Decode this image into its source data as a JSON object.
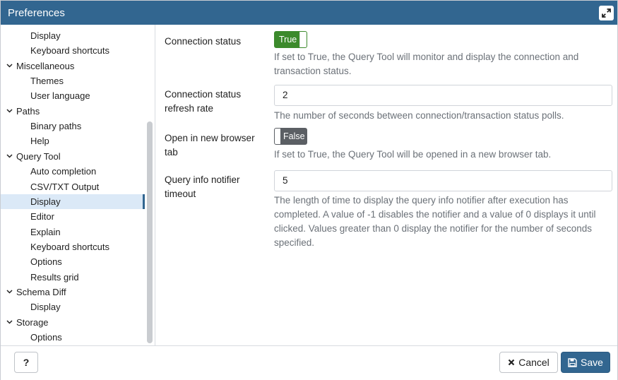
{
  "dialog": {
    "title": "Preferences"
  },
  "tree": [
    {
      "label": "Display",
      "type": "leaf",
      "selected": false
    },
    {
      "label": "Keyboard shortcuts",
      "type": "leaf",
      "selected": false
    },
    {
      "label": "Miscellaneous",
      "type": "group",
      "selected": false
    },
    {
      "label": "Themes",
      "type": "leaf",
      "selected": false
    },
    {
      "label": "User language",
      "type": "leaf",
      "selected": false
    },
    {
      "label": "Paths",
      "type": "group",
      "selected": false
    },
    {
      "label": "Binary paths",
      "type": "leaf",
      "selected": false
    },
    {
      "label": "Help",
      "type": "leaf",
      "selected": false
    },
    {
      "label": "Query Tool",
      "type": "group",
      "selected": false
    },
    {
      "label": "Auto completion",
      "type": "leaf",
      "selected": false
    },
    {
      "label": "CSV/TXT Output",
      "type": "leaf",
      "selected": false
    },
    {
      "label": "Display",
      "type": "leaf",
      "selected": true
    },
    {
      "label": "Editor",
      "type": "leaf",
      "selected": false
    },
    {
      "label": "Explain",
      "type": "leaf",
      "selected": false
    },
    {
      "label": "Keyboard shortcuts",
      "type": "leaf",
      "selected": false
    },
    {
      "label": "Options",
      "type": "leaf",
      "selected": false
    },
    {
      "label": "Results grid",
      "type": "leaf",
      "selected": false
    },
    {
      "label": "Schema Diff",
      "type": "group",
      "selected": false
    },
    {
      "label": "Display",
      "type": "leaf",
      "selected": false
    },
    {
      "label": "Storage",
      "type": "group",
      "selected": false
    },
    {
      "label": "Options",
      "type": "leaf",
      "selected": false
    }
  ],
  "settings": {
    "connection_status": {
      "label": "Connection status",
      "value": "True",
      "help": "If set to True, the Query Tool will monitor and display the connection and transaction status."
    },
    "refresh_rate": {
      "label_line1": "Connection status",
      "label_line2": "refresh rate",
      "value": "2",
      "help": "The number of seconds between connection/transaction status polls."
    },
    "new_tab": {
      "label_line1": "Open in new browser",
      "label_line2": "tab",
      "value": "False",
      "help": "If set to True, the Query Tool will be opened in a new browser tab."
    },
    "notifier_timeout": {
      "label_line1": "Query info notifier",
      "label_line2": "timeout",
      "value": "5",
      "help": "The length of time to display the query info notifier after execution has completed. A value of -1 disables the notifier and a value of 0 displays it until clicked. Values greater than 0 display the notifier for the number of seconds specified."
    }
  },
  "footer": {
    "help_label": "?",
    "cancel_label": "Cancel",
    "save_label": "Save"
  },
  "colors": {
    "titlebar": "#326690",
    "toggle_on": "#3c8a2c",
    "toggle_off": "#5b5f64",
    "selected_row": "#dbe9f7"
  }
}
